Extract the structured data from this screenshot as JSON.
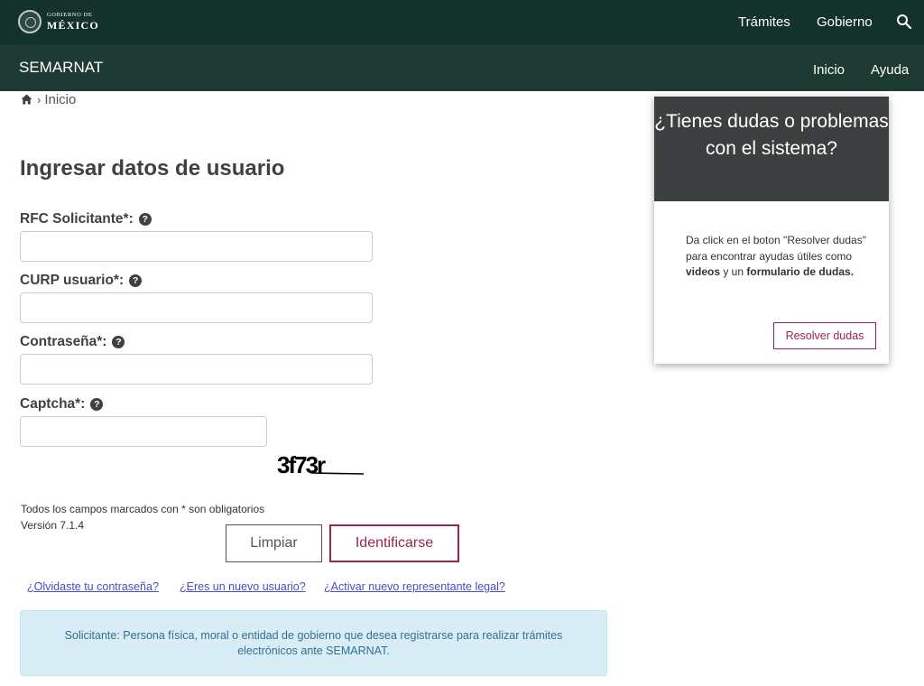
{
  "gov_header": {
    "logo_line1": "GOBIERNO DE",
    "logo_line2": "MÉXICO",
    "nav": [
      "Trámites",
      "Gobierno"
    ],
    "search_icon": "search-icon"
  },
  "sub_header": {
    "brand": "SEMARNAT",
    "nav": [
      "Inicio",
      "Ayuda"
    ]
  },
  "breadcrumb": {
    "home_icon": "home-icon",
    "separator": "›",
    "current": "Inicio"
  },
  "form": {
    "title": "Ingresar datos de usuario",
    "fields": [
      {
        "label": "RFC Solicitante*:",
        "value": ""
      },
      {
        "label": "CURP usuario*:",
        "value": ""
      },
      {
        "label": "Contraseña*:",
        "value": ""
      },
      {
        "label": "Captcha*:",
        "value": ""
      }
    ],
    "help_icon": "question-circle-icon",
    "captcha_text": "3f73r",
    "required_note": "Todos los campos marcados con * son obligatorios",
    "version": "Versión 7.1.4",
    "clear_button": "Limpiar",
    "login_button": "Identificarse",
    "links": [
      "¿Olvidaste tu contraseña?",
      "¿Eres un nuevo usuario?",
      "¿Activar nuevo representante legal?"
    ],
    "info_text": "Solicitante: Persona física, moral o entidad de gobierno que desea registrarse para realizar trámites electrónicos ante SEMARNAT."
  },
  "help_card": {
    "heading": "¿Tienes dudas o problemas con el sistema?",
    "body_part1": "Da click en el boton \"Resolver dudas\" para encontrar ayudas útiles como ",
    "body_videos": "videos",
    "body_part2": " y un ",
    "body_form": "formulario de dudas.",
    "button": "Resolver dudas"
  },
  "colors": {
    "header_bg": "#13322b",
    "subheader_bg": "#1e3b33",
    "accent": "#9d2449",
    "info_bg": "#d9edf7",
    "info_text": "#31708f",
    "link": "#4a4ac2"
  }
}
